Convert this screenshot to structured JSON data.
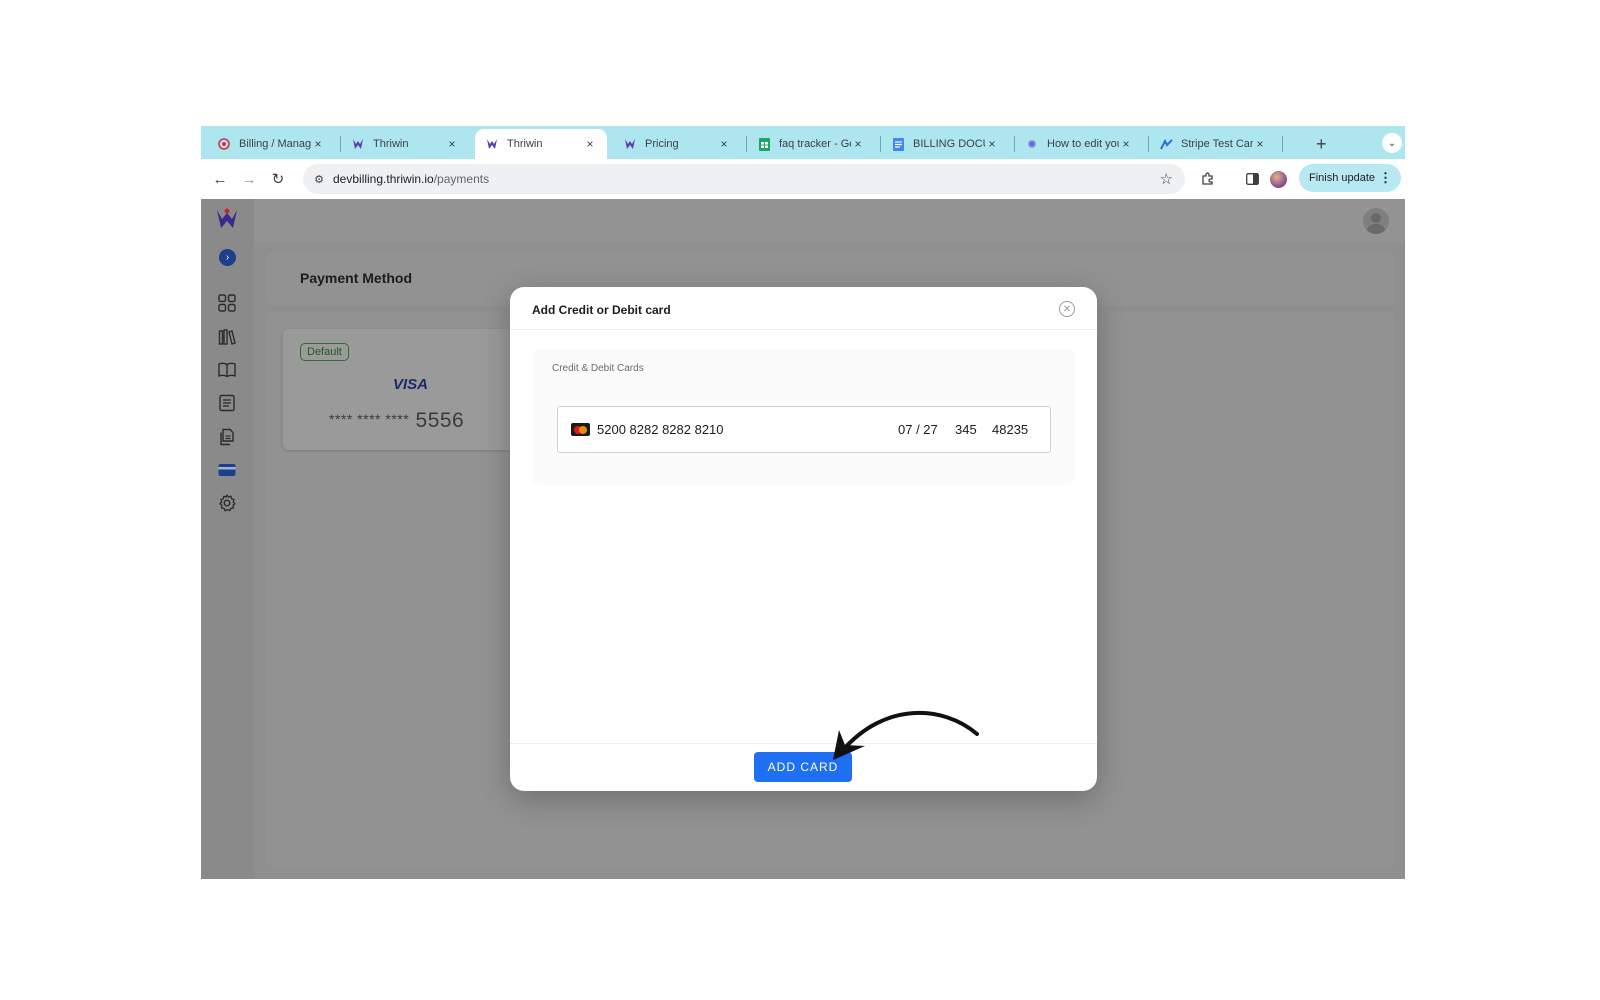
{
  "browser": {
    "tabs": [
      {
        "title": "Billing / Manage",
        "icon": "billing-favicon"
      },
      {
        "title": "Thriwin",
        "icon": "thriwin-favicon"
      },
      {
        "title": "Thriwin",
        "icon": "thriwin-favicon",
        "active": true
      },
      {
        "title": "Pricing",
        "icon": "thriwin-favicon"
      },
      {
        "title": "faq tracker - Go",
        "icon": "google-sheets-favicon"
      },
      {
        "title": "BILLING DOCUM",
        "icon": "google-docs-favicon"
      },
      {
        "title": "How to edit your",
        "icon": "gear-favicon"
      },
      {
        "title": "Stripe Test Card",
        "icon": "stripe-favicon"
      }
    ],
    "close_glyph": "×",
    "new_tab_glyph": "+",
    "url_host": "devbilling.thriwin.io",
    "url_path": "/payments",
    "finish_update_label": "Finish update"
  },
  "app": {
    "sidebar_icons": [
      "dashboard-icon",
      "library-icon",
      "book-icon",
      "list-icon",
      "documents-icon",
      "credit-card-icon",
      "settings-icon"
    ],
    "active_sidebar_icon": "credit-card-icon",
    "page_title": "Payment Method",
    "saved_card": {
      "badge": "Default",
      "brand": "VISA",
      "masked": "**** **** ****",
      "last4": "5556"
    }
  },
  "modal": {
    "title": "Add Credit or Debit card",
    "section_label": "Credit & Debit Cards",
    "card_number": "5200 8282 8282 8210",
    "expiry": "07 / 27",
    "cvc": "345",
    "zip": "48235",
    "submit_label": "ADD CARD"
  },
  "colors": {
    "tabstrip": "#aee6f0",
    "primary_button": "#1e6ff2",
    "active_nav": "#1c3f8c",
    "overlay_gray": "#8f8f8f"
  }
}
